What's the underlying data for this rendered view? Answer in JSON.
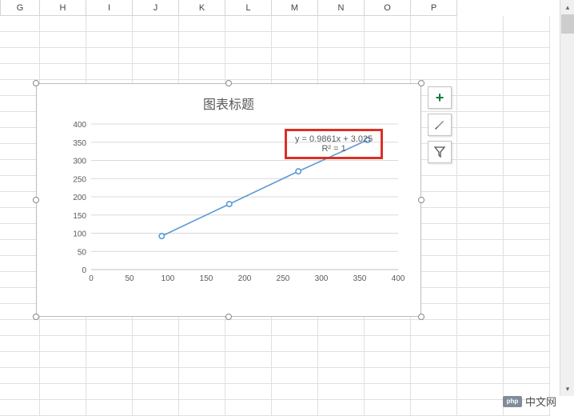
{
  "columns": [
    "G",
    "H",
    "I",
    "J",
    "K",
    "L",
    "M",
    "N",
    "O",
    "P"
  ],
  "chart_data": {
    "type": "scatter",
    "title": "图表标题",
    "xlabel": "",
    "ylabel": "",
    "xlim": [
      0,
      400
    ],
    "ylim": [
      0,
      400
    ],
    "xticks": [
      0,
      50,
      100,
      150,
      200,
      250,
      300,
      350,
      400
    ],
    "yticks": [
      0,
      50,
      100,
      150,
      200,
      250,
      300,
      350,
      400
    ],
    "series": [
      {
        "name": "",
        "x": [
          92,
          180,
          270,
          360
        ],
        "y": [
          92,
          180,
          270,
          356
        ],
        "marker_color": "#5b9bd5",
        "line_color": "#5b9bd5"
      }
    ],
    "trendline": {
      "equation": "y = 0.9861x + 3.025",
      "r_squared": "R² = 1"
    }
  },
  "side_tools": {
    "add": "+",
    "brush": "",
    "filter": ""
  },
  "watermark": {
    "logo_text": "php",
    "label": "中文网"
  }
}
